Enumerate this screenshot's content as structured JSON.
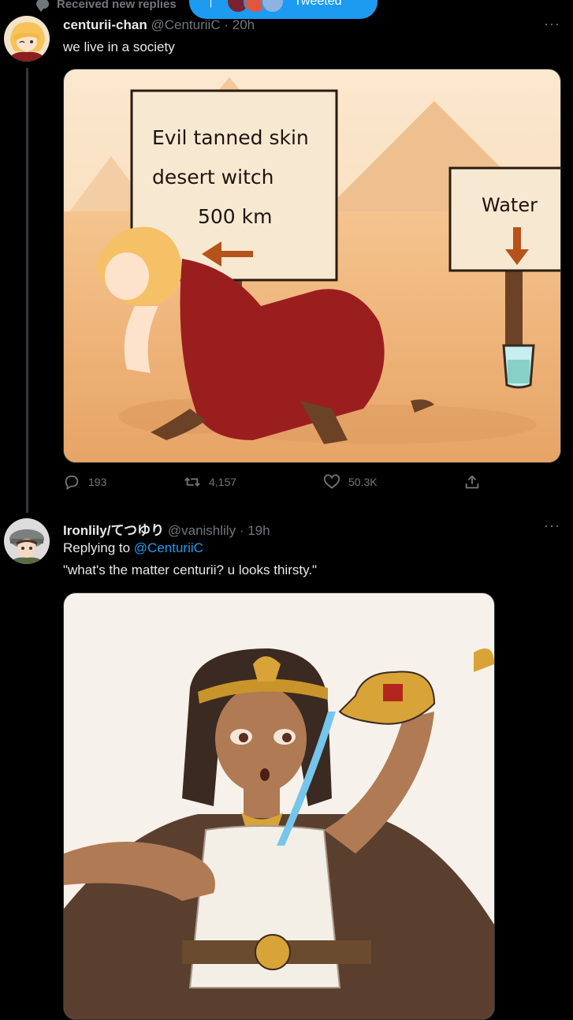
{
  "banner": {
    "received_text": "Received new replies",
    "pill_label": "Tweeted",
    "colors": {
      "accent": "#1d9bf0"
    }
  },
  "tweet1": {
    "name": "centurii-chan",
    "handle": "@CenturiiC",
    "time": "20h",
    "text": "we live in a society",
    "image": {
      "sign_left_line1": "Evil tanned skin",
      "sign_left_line2": "desert witch",
      "sign_left_line3": "500 km",
      "sign_right": "Water"
    },
    "stats": {
      "replies": "193",
      "retweets": "4,157",
      "likes": "50.3K"
    }
  },
  "tweet2": {
    "name": "Ironlily/てつゆり",
    "handle": "@vanishlily",
    "time": "19h",
    "replying_prefix": "Replying to",
    "replying_to": "@CenturiiC",
    "text": "\"what's the matter centurii? u looks thirsty.\""
  },
  "icons": [
    "reply-icon",
    "retweet-icon",
    "like-icon",
    "share-icon",
    "more-icon",
    "arrow-up-icon"
  ]
}
